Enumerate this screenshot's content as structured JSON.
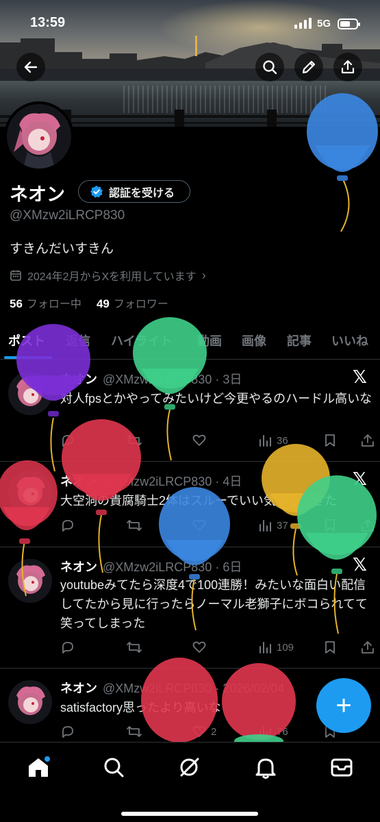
{
  "status_bar": {
    "time": "13:59",
    "network": "5G"
  },
  "header_actions": [
    {
      "name": "back-button",
      "icon": "arrow-left-icon"
    },
    {
      "name": "search-button",
      "icon": "search-icon"
    },
    {
      "name": "edit-button",
      "icon": "pencil-icon"
    },
    {
      "name": "share-button",
      "icon": "share-icon"
    }
  ],
  "profile": {
    "display_name": "ネオン",
    "verify_label": "認証を受ける",
    "handle": "@XMzw2iLRCP830",
    "bio": "すきんだいすきん",
    "joined": "2024年2月からXを利用しています",
    "following_count": "56",
    "following_label": "フォロー中",
    "followers_count": "49",
    "followers_label": "フォロワー"
  },
  "tabs": [
    "ポスト",
    "返信",
    "ハイライト",
    "動画",
    "画像",
    "記事",
    "いいね"
  ],
  "active_tab": 0,
  "posts": [
    {
      "name": "ネオン",
      "handle": "@XMzw2iLRCP830",
      "date": "3日",
      "text": "対人fpsとかやってみたいけど今更やるのハードル高いな",
      "views": "36"
    },
    {
      "name": "ネオン",
      "handle": "@XMzw2iLRCP830",
      "date": "4日",
      "text": "大空洞の貴腐騎士2体はスルーでいい気がしてきた",
      "views": "37"
    },
    {
      "name": "ネオン",
      "handle": "@XMzw2iLRCP830",
      "date": "6日",
      "text": "youtubeみてたら深度4で100連勝！みたいな面白い配信してたから見に行ったらノーマル老獅子にボコられてて笑ってしまった",
      "views": "109"
    },
    {
      "name": "ネオン",
      "handle": "@XMzw2iLRCP830",
      "date": "2026/02/04",
      "text": "satisfactory思ったより高いな",
      "likes": "2",
      "views": "76"
    }
  ],
  "fab": {
    "label": "+"
  },
  "bottom_nav": [
    "home-icon",
    "search-icon",
    "grok-icon",
    "bell-icon",
    "mail-icon"
  ],
  "colors": {
    "accent": "#1d9bf0",
    "background": "#000000",
    "muted": "#71767b",
    "balloon_blue": "#3b86e0",
    "balloon_purple": "#7b2fd6",
    "balloon_green": "#3fcf8a",
    "balloon_red": "#e0364f",
    "balloon_yellow": "#e6b32b"
  }
}
